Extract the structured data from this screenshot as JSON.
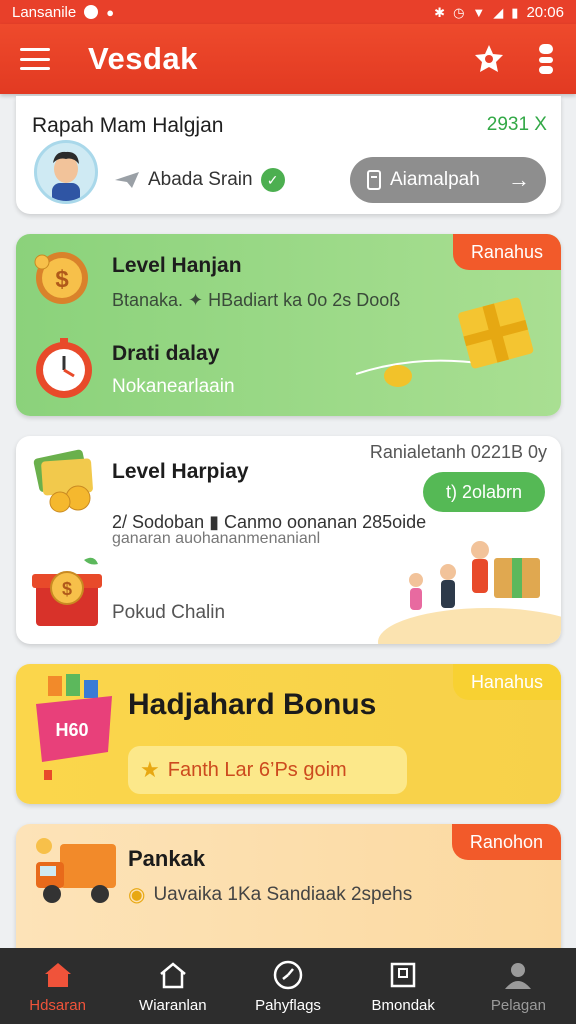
{
  "status_bar": {
    "left_text": "Lansanile",
    "time": "20:06"
  },
  "app_bar": {
    "title": "Vesdak"
  },
  "card1": {
    "title": "Rapah Mam Halgjan",
    "count": "2931 X",
    "sender": "Abada Srain",
    "button_label": "Aiamalpah"
  },
  "card2": {
    "badge": "Ranahus",
    "title": "Level Hanjan",
    "description": "Btanaka. ✦ HBadiart ka 0o 2s Dooß",
    "sub_title": "Drati dalay",
    "sub_description": "Nokanearlaain"
  },
  "card3": {
    "top_right": "Ranialetanh 0221B 0y",
    "title": "Level Harpiay",
    "button_label": "t) 2olabrn",
    "description": "2/ Sodoban ▮ Canmo oonanan 285oide",
    "description2": "ganaran auohananmenanianl",
    "footer": "Pokud Chalin"
  },
  "card4": {
    "badge": "Hanahus",
    "title": "Hadjahard Bonus",
    "pill_label": "Fanth Lar 6’Ps goim"
  },
  "card5": {
    "badge": "Ranohon",
    "title": "Pankak",
    "description": "Uavaika 1Ka Sandiaak 2spehs"
  },
  "bottom_nav": [
    {
      "label": "Hdsaran",
      "icon": "home-icon"
    },
    {
      "label": "Wiaranlan",
      "icon": "house-outline-icon"
    },
    {
      "label": "Pahyflags",
      "icon": "clock-icon"
    },
    {
      "label": "Bmondak",
      "icon": "box-icon"
    },
    {
      "label": "Pelagan",
      "icon": "person-icon"
    }
  ],
  "colors": {
    "accent": "#e8402a",
    "green": "#5cb85c",
    "yellow": "#fbd64b",
    "nav_bg": "#2d2d2d"
  }
}
